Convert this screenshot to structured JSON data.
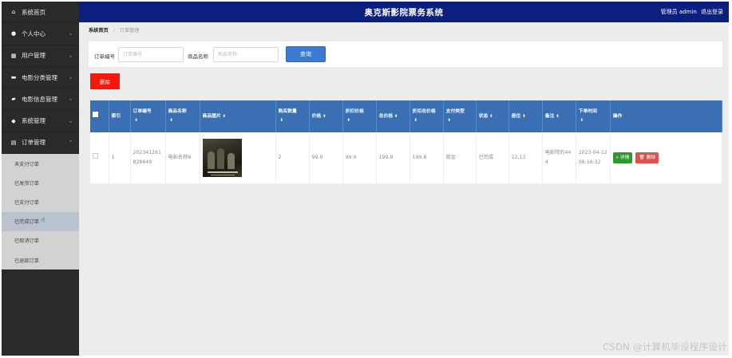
{
  "app": {
    "title": "奥克斯影院票务系统",
    "user_label": "管理员 admin",
    "logout": "退出登录"
  },
  "sidebar": {
    "items": [
      {
        "label": "系统首页",
        "icon": "home-icon",
        "glyph": "⌂",
        "chevron": ""
      },
      {
        "label": "个人中心",
        "icon": "user-icon",
        "glyph": "●",
        "chevron": "⌄"
      },
      {
        "label": "用户管理",
        "icon": "grid-icon",
        "glyph": "▦",
        "chevron": "⌄"
      },
      {
        "label": "电影分类管理",
        "icon": "comment-icon",
        "glyph": "▬",
        "chevron": "⌄"
      },
      {
        "label": "电影信息管理",
        "icon": "briefcase-icon",
        "glyph": "▰",
        "chevron": "⌄"
      },
      {
        "label": "系统管理",
        "icon": "thumbs-up-icon",
        "glyph": "◆",
        "chevron": "⌄"
      },
      {
        "label": "订单管理",
        "icon": "clipboard-icon",
        "glyph": "▤",
        "chevron": "⌃"
      }
    ],
    "order_submenu": [
      {
        "label": "未支付订单"
      },
      {
        "label": "已发货订单"
      },
      {
        "label": "已支付订单"
      },
      {
        "label": "已完成订单"
      },
      {
        "label": "已取消订单"
      },
      {
        "label": "已退款订单"
      }
    ]
  },
  "breadcrumb": {
    "home": "系统首页",
    "current": "订单管理"
  },
  "search": {
    "order_no_label": "订单编号",
    "order_no_placeholder": "订单编号",
    "order_no_value": "",
    "product_label": "商品名称",
    "product_placeholder": "商品名称",
    "product_value": "",
    "query_button": "查询"
  },
  "actions": {
    "delete_button": "删除"
  },
  "table": {
    "columns": [
      "索引",
      "订单编号",
      "商品名称",
      "商品图片",
      "购买数量",
      "价格",
      "折扣价格",
      "总价格",
      "折扣总价格",
      "支付类型",
      "状态",
      "座位",
      "备注",
      "下单时间",
      "操作"
    ],
    "rows": [
      {
        "index": "1",
        "order_no": "202341261828849",
        "product_name": "电影名称8",
        "quantity": "2",
        "price": "99.9",
        "discount_price": "99.9",
        "total": "199.8",
        "discount_total": "199.8",
        "pay_type": "现金",
        "status": "已完成",
        "seat": "12,13",
        "remark": "电影院的444",
        "order_time": "2023-04-12 06:16:32",
        "detail_button": "详情",
        "delete_button": "删除"
      }
    ]
  },
  "watermark": "CSDN @计算机毕设程序设计",
  "colors": {
    "header_bg": "#0b1f7f",
    "sidebar_bg": "#2a2a2a",
    "table_header": "#3a6fb3",
    "query_button": "#3c7bd0",
    "delete_button": "#f5170f",
    "detail_button": "#2c9a2c",
    "row_delete_button": "#d9534f"
  }
}
